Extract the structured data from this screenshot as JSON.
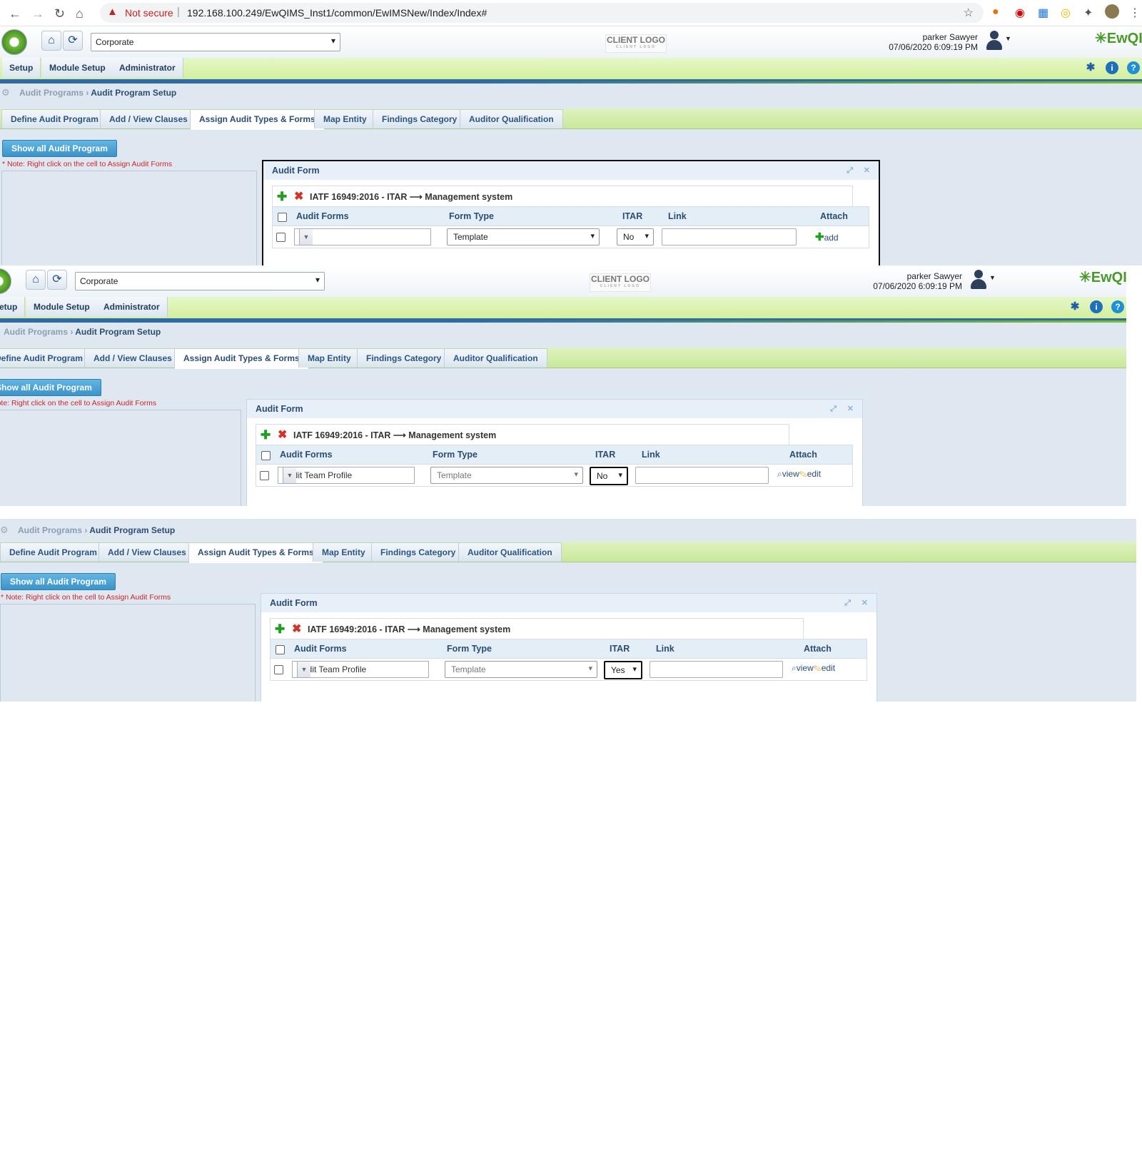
{
  "browser": {
    "security_label": "Not secure",
    "url": "192.168.100.249/EwQIMS_Inst1/common/EwIMSNew/Index/Index#"
  },
  "app": {
    "company": "Corporate",
    "client_logo": "CLIENT LOGO",
    "client_logo_sub": "CLIENT LOGO",
    "user_name": "parker Sawyer",
    "datetime": "07/06/2020 6:09:19 PM",
    "brand": "EwQIMS",
    "menu": [
      "Setup",
      "Module Setup",
      "Administrator"
    ]
  },
  "breadcrumb": {
    "parent": "Audit Programs",
    "current": "Audit Program Setup"
  },
  "tabs": [
    "Define Audit Program",
    "Add / View Clauses",
    "Assign Audit Types & Forms",
    "Map Entity",
    "Findings Category",
    "Auditor Qualification"
  ],
  "active_tab": "Assign Audit Types & Forms",
  "show_all_button": "Show all Audit Program",
  "note": "* Note: Right click on the cell to Assign Audit Forms",
  "dialog": {
    "title": "Audit Form",
    "grid_title": "IATF 16949:2016 - ITAR",
    "grid_target": "Management system",
    "columns": [
      "Audit Forms",
      "Form Type",
      "ITAR",
      "Link",
      "Attach"
    ]
  },
  "states": [
    {
      "audit_form": "",
      "form_type": "Template",
      "itar": "No",
      "link": "",
      "attach": [
        "add"
      ]
    },
    {
      "audit_form": "Audit Team Profile",
      "form_type": "Template",
      "itar": "No",
      "link": "",
      "attach": [
        "view",
        "edit"
      ]
    },
    {
      "audit_form": "Audit Team Profile",
      "form_type": "Template",
      "itar": "Yes",
      "link": "",
      "attach": [
        "view",
        "edit"
      ]
    }
  ],
  "colors": {
    "menu_green": "#d3ef9d",
    "accent_blue": "#2c6aa8",
    "note_red": "#d0242b",
    "button_blue": "#3b93c9"
  }
}
